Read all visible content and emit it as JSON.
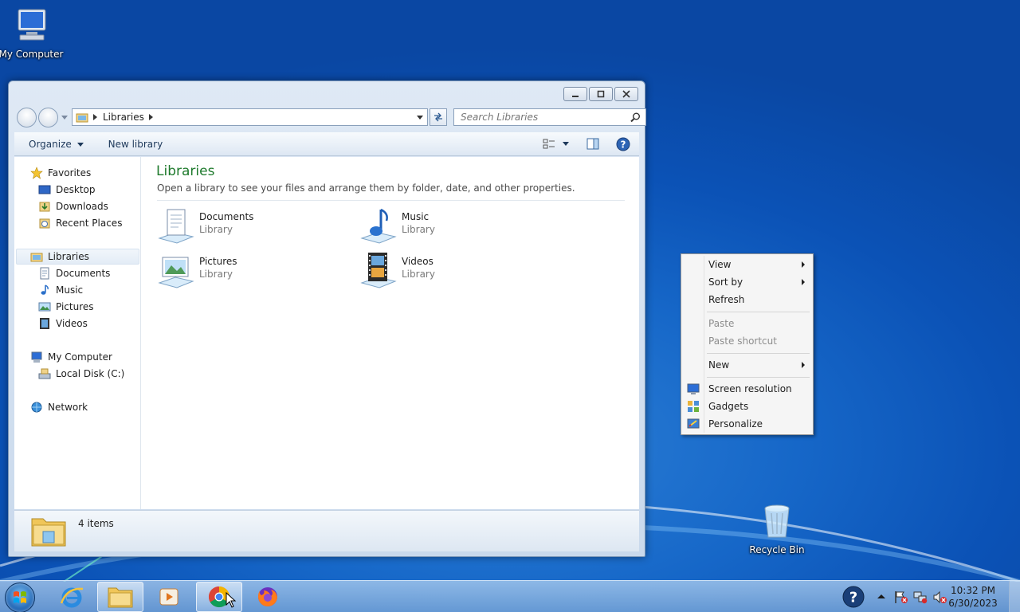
{
  "desktop": {
    "icons": [
      {
        "label": "My Computer"
      },
      {
        "label": "Recycle Bin"
      }
    ]
  },
  "window": {
    "address_crumb": "Libraries",
    "search_placeholder": "Search Libraries",
    "toolbar": {
      "organize": "Organize",
      "new_library": "New library"
    },
    "nav": {
      "favorites": "Favorites",
      "desktop": "Desktop",
      "downloads": "Downloads",
      "recent": "Recent Places",
      "libraries": "Libraries",
      "documents": "Documents",
      "music": "Music",
      "pictures": "Pictures",
      "videos": "Videos",
      "computer": "My Computer",
      "local_disk": "Local Disk (C:)",
      "network": "Network"
    },
    "main": {
      "title": "Libraries",
      "description": "Open a library to see your files and arrange them by folder, date, and other properties.",
      "items": [
        {
          "name": "Documents",
          "type": "Library"
        },
        {
          "name": "Music",
          "type": "Library"
        },
        {
          "name": "Pictures",
          "type": "Library"
        },
        {
          "name": "Videos",
          "type": "Library"
        }
      ]
    },
    "details": {
      "count": "4 items"
    }
  },
  "context_menu": {
    "view": "View",
    "sort_by": "Sort by",
    "refresh": "Refresh",
    "paste": "Paste",
    "paste_shortcut": "Paste shortcut",
    "new": "New",
    "screen_resolution": "Screen resolution",
    "gadgets": "Gadgets",
    "personalize": "Personalize"
  },
  "taskbar": {
    "time": "10:32 PM",
    "date": "6/30/2023"
  },
  "colors": {
    "desktop_blue": "#0b52b6",
    "library_title_green": "#1e7a2c"
  }
}
